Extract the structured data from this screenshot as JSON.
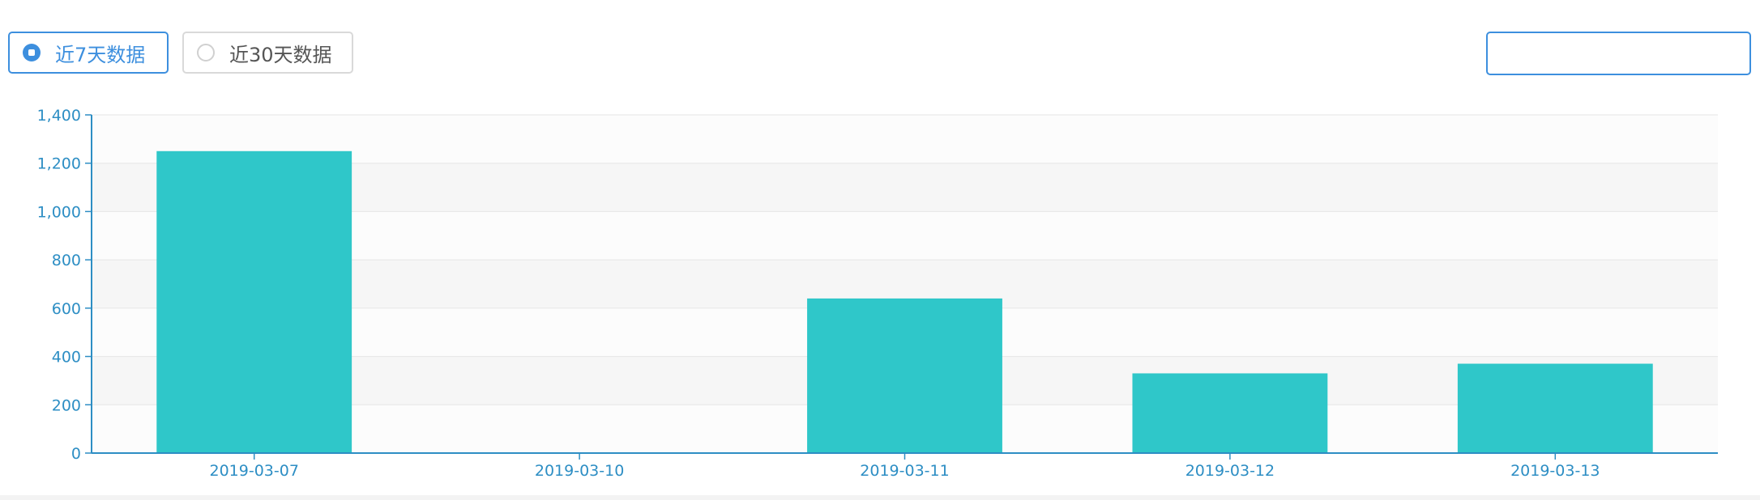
{
  "controls": {
    "range_options": [
      {
        "label": "近7天数据",
        "selected": true
      },
      {
        "label": "近30天数据",
        "selected": false
      }
    ],
    "date_input": {
      "value": "",
      "placeholder": ""
    }
  },
  "colors": {
    "accent": "#3d8fde",
    "bar": "#2fc7c9",
    "axis": "#2d8ec4"
  },
  "chart_data": {
    "type": "bar",
    "title": "",
    "xlabel": "",
    "ylabel": "",
    "categories": [
      "2019-03-07",
      "2019-03-10",
      "2019-03-11",
      "2019-03-12",
      "2019-03-13"
    ],
    "values": [
      1250,
      0,
      640,
      330,
      370
    ],
    "ylim": [
      0,
      1400
    ],
    "yticks": [
      0,
      200,
      400,
      600,
      800,
      1000,
      1200,
      1400
    ],
    "ytick_labels": [
      "0",
      "200",
      "400",
      "600",
      "800",
      "1,000",
      "1,200",
      "1,400"
    ],
    "grid": true,
    "legend": "none"
  }
}
